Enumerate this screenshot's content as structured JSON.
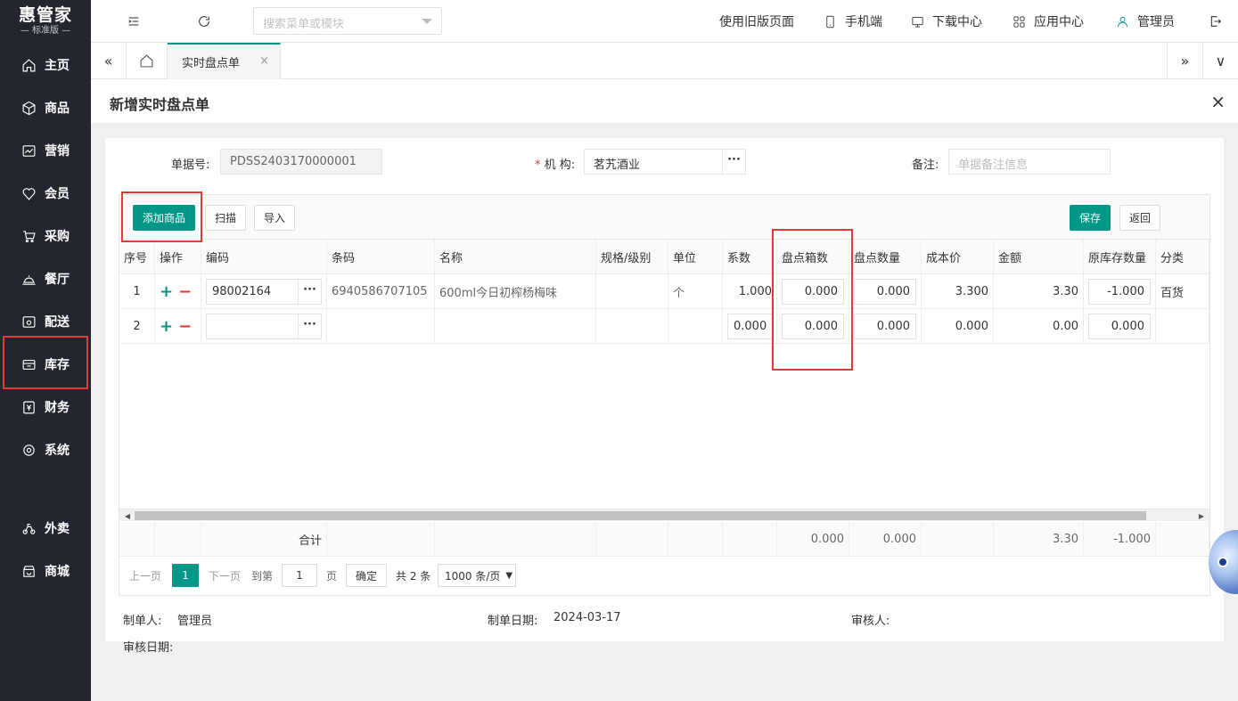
{
  "app": {
    "logo_title": "惠管家",
    "logo_sub": "— 标准版 —"
  },
  "sidebar": {
    "items": [
      {
        "label": "主页",
        "icon": "home-icon"
      },
      {
        "label": "商品",
        "icon": "box-icon"
      },
      {
        "label": "营销",
        "icon": "chart-icon"
      },
      {
        "label": "会员",
        "icon": "heart-icon"
      },
      {
        "label": "采购",
        "icon": "cart-icon"
      },
      {
        "label": "餐厅",
        "icon": "dish-icon"
      },
      {
        "label": "配送",
        "icon": "truck-icon"
      },
      {
        "label": "库存",
        "icon": "inventory-icon"
      },
      {
        "label": "财务",
        "icon": "finance-icon"
      },
      {
        "label": "系统",
        "icon": "gear-icon"
      },
      {
        "label": "外卖",
        "icon": "takeout-icon"
      },
      {
        "label": "商城",
        "icon": "shop-icon"
      }
    ]
  },
  "topbar": {
    "search_placeholder": "搜索菜单或模块",
    "old_version": "使用旧版页面",
    "mobile": "手机端",
    "download": "下载中心",
    "apps": "应用中心",
    "user": "管理员"
  },
  "tabs": {
    "active": "实时盘点单",
    "close": "×",
    "collapse": "«",
    "expand": "»",
    "menu": "∨"
  },
  "panel": {
    "title": "新增实时盘点单",
    "close": "×"
  },
  "form": {
    "doc_no_label": "单据号:",
    "doc_no_value": "PDSS2403170000001",
    "org_required": "*",
    "org_label": "机 构:",
    "org_value": "茗艽酒业",
    "remark_label": "备注:",
    "remark_placeholder": "单据备注信息",
    "dots": "···"
  },
  "toolbar": {
    "add": "添加商品",
    "scan": "扫描",
    "import": "导入",
    "save": "保存",
    "back": "返回"
  },
  "table": {
    "headers": [
      "序号",
      "操作",
      "编码",
      "条码",
      "名称",
      "规格/级别",
      "单位",
      "系数",
      "盘点箱数",
      "盘点数量",
      "成本价",
      "金额",
      "原库存数量",
      "分类"
    ],
    "rows": [
      {
        "no": "1",
        "code": "98002164",
        "barcode": "6940586707105",
        "name": "600ml今日初榨杨梅味",
        "spec": "",
        "unit": "个",
        "factor": "1.000",
        "boxes": "0.000",
        "qty": "0.000",
        "cost": "3.300",
        "amount": "3.30",
        "orig_stock": "-1.000",
        "category": "百货"
      },
      {
        "no": "2",
        "code": "",
        "barcode": "",
        "name": "",
        "spec": "",
        "unit": "",
        "factor": "0.000",
        "boxes": "0.000",
        "qty": "0.000",
        "cost": "0.000",
        "amount": "0.00",
        "orig_stock": "0.000",
        "category": ""
      }
    ],
    "plus": "+",
    "minus": "−",
    "sum_label": "合计",
    "sum": {
      "boxes": "0.000",
      "qty": "0.000",
      "amount": "3.30",
      "orig_stock": "-1.000"
    }
  },
  "pager": {
    "prev": "上一页",
    "current": "1",
    "next": "下一页",
    "goto": "到第",
    "page_input": "1",
    "page_unit": "页",
    "confirm": "确定",
    "total": "共 2 条",
    "page_size": "1000 条/页"
  },
  "footer": {
    "creator_label": "制单人:",
    "creator": "管理员",
    "date_label": "制单日期:",
    "date": "2024-03-17",
    "reviewer_label": "审核人:",
    "review_date_label": "审核日期:"
  }
}
